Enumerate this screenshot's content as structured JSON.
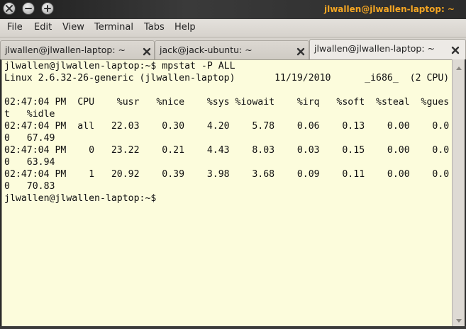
{
  "window": {
    "title": "jlwallen@jlwallen-laptop: ~",
    "controls": [
      "close-icon",
      "minimize-icon",
      "maximize-icon"
    ]
  },
  "menu": {
    "items": [
      {
        "label": "File"
      },
      {
        "label": "Edit"
      },
      {
        "label": "View"
      },
      {
        "label": "Terminal"
      },
      {
        "label": "Tabs"
      },
      {
        "label": "Help"
      }
    ]
  },
  "tabs": [
    {
      "label": "jlwallen@jlwallen-laptop: ~",
      "active": false
    },
    {
      "label": "jack@jack-ubuntu: ~",
      "active": false
    },
    {
      "label": "jlwallen@jlwallen-laptop: ~",
      "active": true
    }
  ],
  "terminal": {
    "lines": [
      "jlwallen@jlwallen-laptop:~$ mpstat -P ALL",
      "Linux 2.6.32-26-generic (jlwallen-laptop)       11/19/2010      _i686_  (2 CPU)",
      "",
      "02:47:04 PM  CPU    %usr   %nice    %sys %iowait    %irq   %soft  %steal  %gues",
      "t   %idle",
      "02:47:04 PM  all   22.03    0.30    4.20    5.78    0.06    0.13    0.00    0.0",
      "0   67.49",
      "02:47:04 PM    0   23.22    0.21    4.43    8.03    0.03    0.15    0.00    0.0",
      "0   63.94",
      "02:47:04 PM    1   20.92    0.39    3.98    3.68    0.09    0.11    0.00    0.0",
      "0   70.83",
      "jlwallen@jlwallen-laptop:~$"
    ]
  },
  "colors": {
    "title_text": "#f5a623",
    "terminal_bg": "#fcfcdc"
  }
}
